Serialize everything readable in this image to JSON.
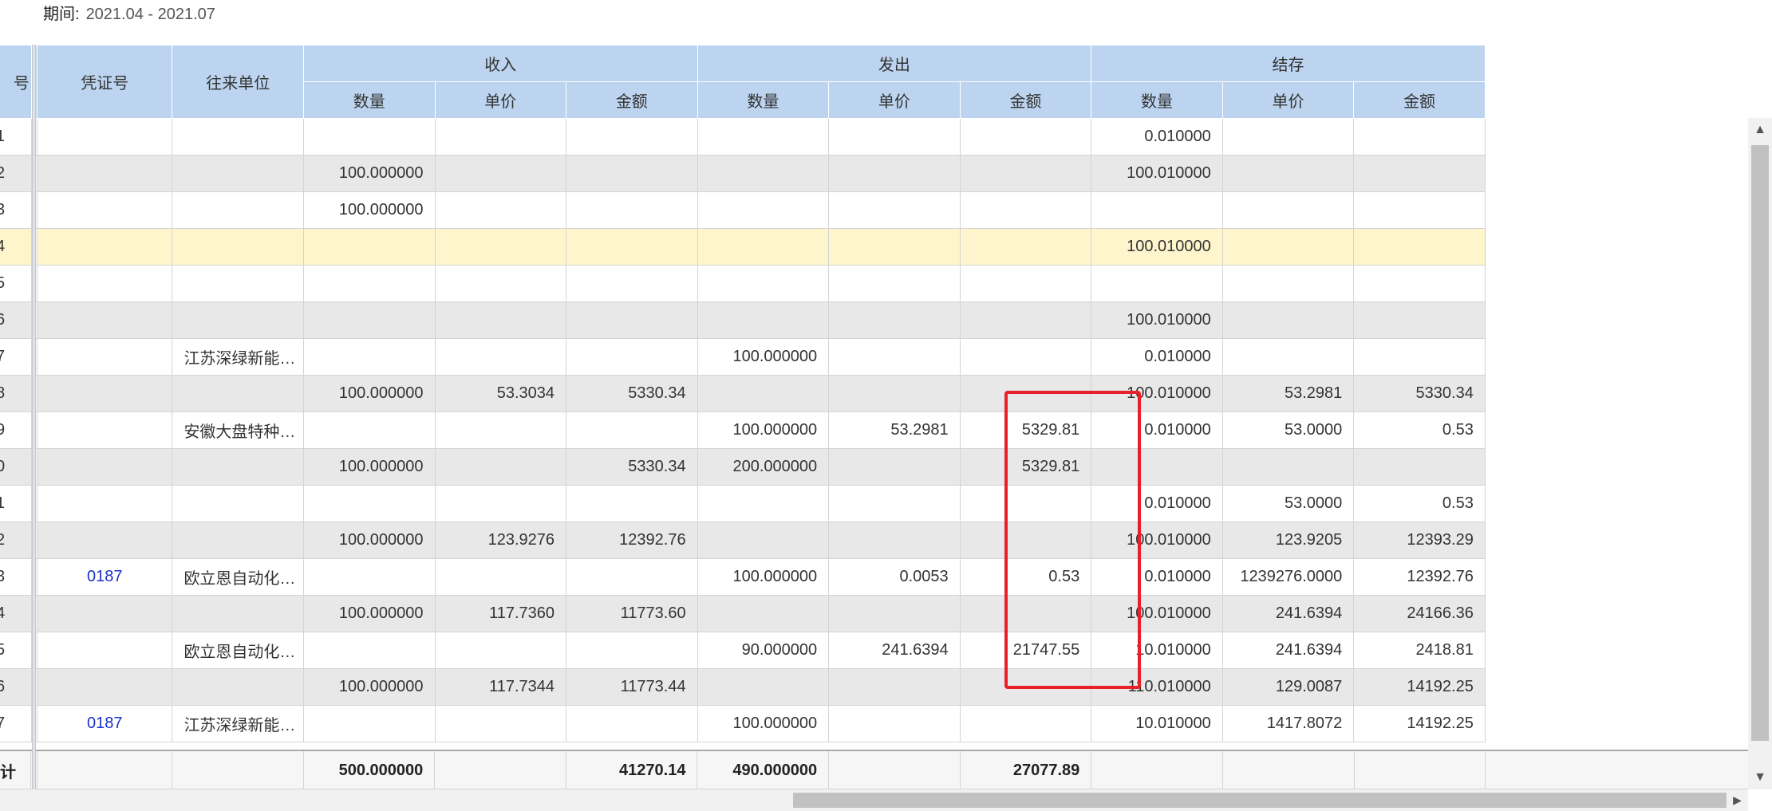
{
  "period": {
    "label": "期间:",
    "value": "2021.04 - 2021.07"
  },
  "headers": {
    "seq": "号",
    "voucher": "凭证号",
    "partner": "往来单位",
    "income": "收入",
    "issue": "发出",
    "balance": "结存",
    "qty": "数量",
    "price": "单价",
    "amount": "金额"
  },
  "rows": [
    {
      "seq": "1",
      "voucher": "",
      "partner": "",
      "in_qty": "",
      "in_price": "",
      "in_amt": "",
      "out_qty": "",
      "out_price": "",
      "out_amt": "",
      "bal_qty": "0.010000",
      "bal_price": "",
      "bal_amt": ""
    },
    {
      "seq": "2",
      "voucher": "",
      "partner": "",
      "in_qty": "100.000000",
      "in_price": "",
      "in_amt": "",
      "out_qty": "",
      "out_price": "",
      "out_amt": "",
      "bal_qty": "100.010000",
      "bal_price": "",
      "bal_amt": ""
    },
    {
      "seq": "3",
      "voucher": "",
      "partner": "",
      "in_qty": "100.000000",
      "in_price": "",
      "in_amt": "",
      "out_qty": "",
      "out_price": "",
      "out_amt": "",
      "bal_qty": "",
      "bal_price": "",
      "bal_amt": ""
    },
    {
      "seq": "4",
      "voucher": "",
      "partner": "",
      "in_qty": "",
      "in_price": "",
      "in_amt": "",
      "out_qty": "",
      "out_price": "",
      "out_amt": "",
      "bal_qty": "100.010000",
      "bal_price": "",
      "bal_amt": ""
    },
    {
      "seq": "5",
      "voucher": "",
      "partner": "",
      "in_qty": "",
      "in_price": "",
      "in_amt": "",
      "out_qty": "",
      "out_price": "",
      "out_amt": "",
      "bal_qty": "",
      "bal_price": "",
      "bal_amt": ""
    },
    {
      "seq": "6",
      "voucher": "",
      "partner": "",
      "in_qty": "",
      "in_price": "",
      "in_amt": "",
      "out_qty": "",
      "out_price": "",
      "out_amt": "",
      "bal_qty": "100.010000",
      "bal_price": "",
      "bal_amt": ""
    },
    {
      "seq": "7",
      "voucher": "",
      "partner": "江苏深绿新能…",
      "in_qty": "",
      "in_price": "",
      "in_amt": "",
      "out_qty": "100.000000",
      "out_price": "",
      "out_amt": "",
      "bal_qty": "0.010000",
      "bal_price": "",
      "bal_amt": ""
    },
    {
      "seq": "8",
      "voucher": "",
      "partner": "",
      "in_qty": "100.000000",
      "in_price": "53.3034",
      "in_amt": "5330.34",
      "out_qty": "",
      "out_price": "",
      "out_amt": "",
      "bal_qty": "100.010000",
      "bal_price": "53.2981",
      "bal_amt": "5330.34"
    },
    {
      "seq": "9",
      "voucher": "",
      "partner": "安徽大盘特种…",
      "in_qty": "",
      "in_price": "",
      "in_amt": "",
      "out_qty": "100.000000",
      "out_price": "53.2981",
      "out_amt": "5329.81",
      "bal_qty": "0.010000",
      "bal_price": "53.0000",
      "bal_amt": "0.53"
    },
    {
      "seq": "0",
      "voucher": "",
      "partner": "",
      "in_qty": "100.000000",
      "in_price": "",
      "in_amt": "5330.34",
      "out_qty": "200.000000",
      "out_price": "",
      "out_amt": "5329.81",
      "bal_qty": "",
      "bal_price": "",
      "bal_amt": ""
    },
    {
      "seq": "1",
      "voucher": "",
      "partner": "",
      "in_qty": "",
      "in_price": "",
      "in_amt": "",
      "out_qty": "",
      "out_price": "",
      "out_amt": "",
      "bal_qty": "0.010000",
      "bal_price": "53.0000",
      "bal_amt": "0.53"
    },
    {
      "seq": "2",
      "voucher": "",
      "partner": "",
      "in_qty": "100.000000",
      "in_price": "123.9276",
      "in_amt": "12392.76",
      "out_qty": "",
      "out_price": "",
      "out_amt": "",
      "bal_qty": "100.010000",
      "bal_price": "123.9205",
      "bal_amt": "12393.29"
    },
    {
      "seq": "3",
      "voucher": "0187",
      "partner": "欧立恩自动化…",
      "in_qty": "",
      "in_price": "",
      "in_amt": "",
      "out_qty": "100.000000",
      "out_price": "0.0053",
      "out_amt": "0.53",
      "bal_qty": "0.010000",
      "bal_price": "1239276.0000",
      "bal_amt": "12392.76"
    },
    {
      "seq": "4",
      "voucher": "",
      "partner": "",
      "in_qty": "100.000000",
      "in_price": "117.7360",
      "in_amt": "11773.60",
      "out_qty": "",
      "out_price": "",
      "out_amt": "",
      "bal_qty": "100.010000",
      "bal_price": "241.6394",
      "bal_amt": "24166.36"
    },
    {
      "seq": "5",
      "voucher": "",
      "partner": "欧立恩自动化…",
      "in_qty": "",
      "in_price": "",
      "in_amt": "",
      "out_qty": "90.000000",
      "out_price": "241.6394",
      "out_amt": "21747.55",
      "bal_qty": "10.010000",
      "bal_price": "241.6394",
      "bal_amt": "2418.81"
    },
    {
      "seq": "6",
      "voucher": "",
      "partner": "",
      "in_qty": "100.000000",
      "in_price": "117.7344",
      "in_amt": "11773.44",
      "out_qty": "",
      "out_price": "",
      "out_amt": "",
      "bal_qty": "110.010000",
      "bal_price": "129.0087",
      "bal_amt": "14192.25"
    },
    {
      "seq": "7",
      "voucher": "0187",
      "partner": "江苏深绿新能…",
      "in_qty": "",
      "in_price": "",
      "in_amt": "",
      "out_qty": "100.000000",
      "out_price": "",
      "out_amt": "",
      "bal_qty": "10.010000",
      "bal_price": "1417.8072",
      "bal_amt": "14192.25"
    }
  ],
  "selected_row": 3,
  "total": {
    "label": "计",
    "in_qty": "500.000000",
    "in_amt": "41270.14",
    "out_qty": "490.000000",
    "out_amt": "27077.89"
  },
  "colors": {
    "header_bg": "#bcd4ef",
    "row_alt_bg": "#e8e8e8",
    "selected_bg": "#fef5cc",
    "link": "#1a33cc",
    "annotation": "#e8202a"
  },
  "icons": {
    "scroll_up": "▲",
    "scroll_down": "▼",
    "scroll_right": "▶"
  }
}
